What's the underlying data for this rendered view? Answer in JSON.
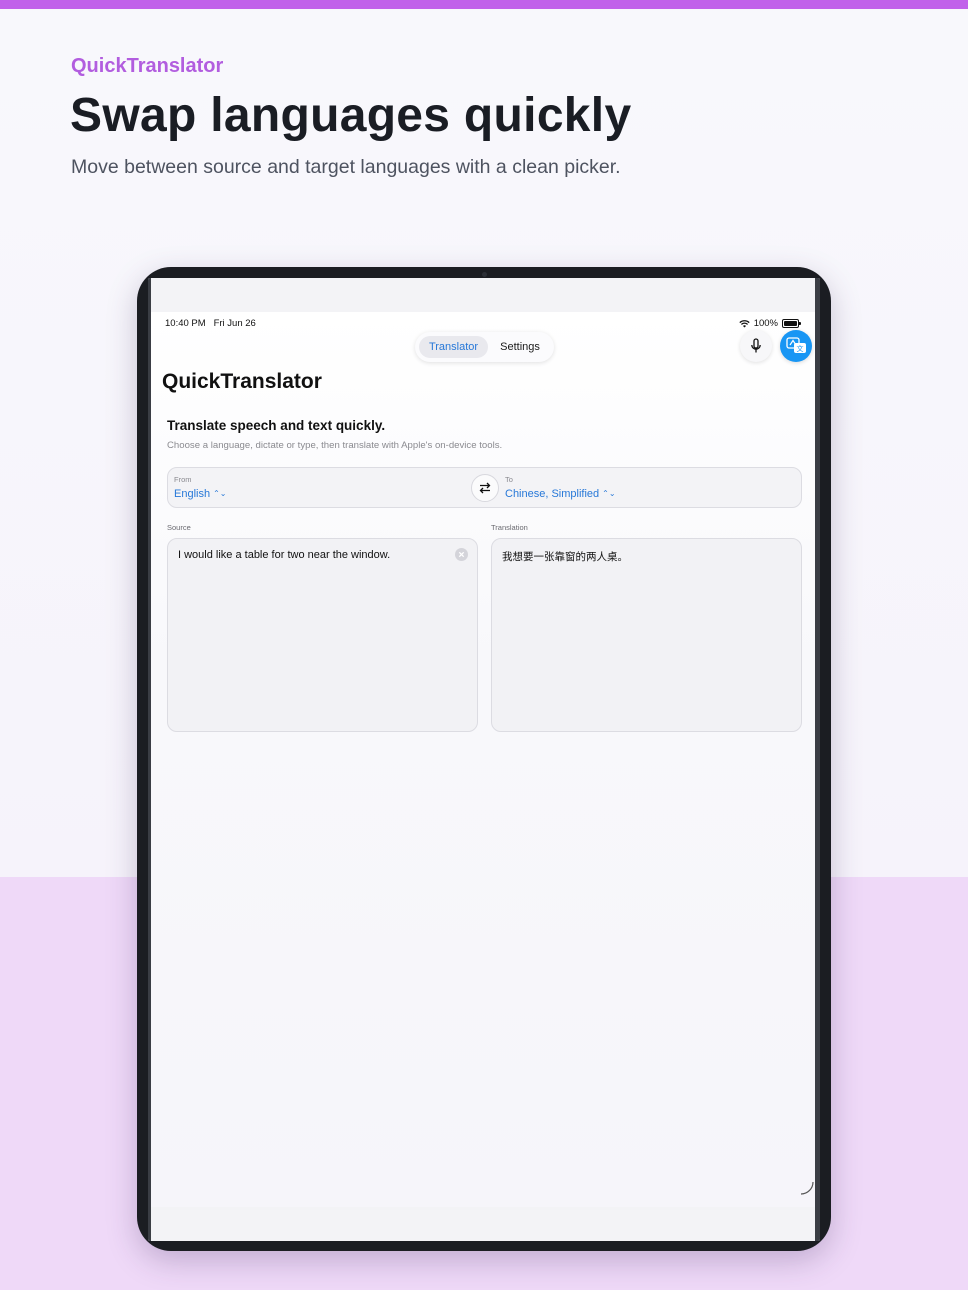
{
  "brand": {
    "name": "QuickTranslator"
  },
  "headline": "Swap languages quickly",
  "subhead": "Move between source and target languages with a clean picker.",
  "colors": {
    "accent": "#c162ea",
    "link": "#2778d8",
    "primary_button": "#1896f4",
    "bottom_band": "#efd9f8"
  },
  "status_bar": {
    "time": "10:40 PM   Fri Jun 26",
    "battery": "100%"
  },
  "tabs": [
    {
      "label": "Translator",
      "active": true
    },
    {
      "label": "Settings",
      "active": false
    }
  ],
  "toolbar": {
    "mic_icon": "microphone-icon",
    "translate_icon": "translate-icon"
  },
  "app": {
    "title": "QuickTranslator",
    "card_title": "Translate speech and text quickly.",
    "card_subtitle": "Choose a language, dictate or type, then translate with Apple's on-device tools."
  },
  "language_picker": {
    "from_label": "From",
    "from_value": "English",
    "to_label": "To",
    "to_value": "Chinese, Simplified",
    "swap_icon": "swap-arrows-icon"
  },
  "source": {
    "label": "Source",
    "text": "I would like a table for two near the window."
  },
  "translation": {
    "label": "Translation",
    "text": "我想要一张靠窗的两人桌。"
  }
}
